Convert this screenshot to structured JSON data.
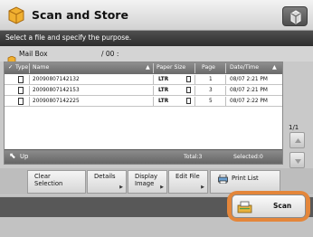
{
  "header": {
    "title": "Scan and Store"
  },
  "instruction": "Select a file and specify the purpose.",
  "mailbox": {
    "label": "Mail Box",
    "value": "/ 00 :"
  },
  "table": {
    "columns": {
      "type": "Type",
      "name": "Name",
      "paper_size": "Paper Size",
      "page": "Page",
      "datetime": "Date/Time"
    },
    "rows": [
      {
        "name": "20090807142132",
        "paper_size": "LTR",
        "page": "1",
        "datetime": "08/07 2:21 PM"
      },
      {
        "name": "20090807142153",
        "paper_size": "LTR",
        "page": "3",
        "datetime": "08/07 2:21 PM"
      },
      {
        "name": "20090807142225",
        "paper_size": "LTR",
        "page": "5",
        "datetime": "08/07 2:22 PM"
      }
    ]
  },
  "list_footer": {
    "up": "Up",
    "total": "Total:3",
    "selected": "Selected:0"
  },
  "scroll": {
    "page_indicator": "1/1"
  },
  "buttons": {
    "clear_selection_line1": "Clear",
    "clear_selection_line2": "Selection",
    "details": "Details",
    "display_image_line1": "Display",
    "display_image_line2": "Image",
    "edit_file": "Edit File",
    "print_list": "Print List"
  },
  "scan": {
    "label": "Scan"
  },
  "colors": {
    "highlight": "#e4863a",
    "header_dark": "#2d2d2d",
    "list_header": "#6a6a6a"
  }
}
